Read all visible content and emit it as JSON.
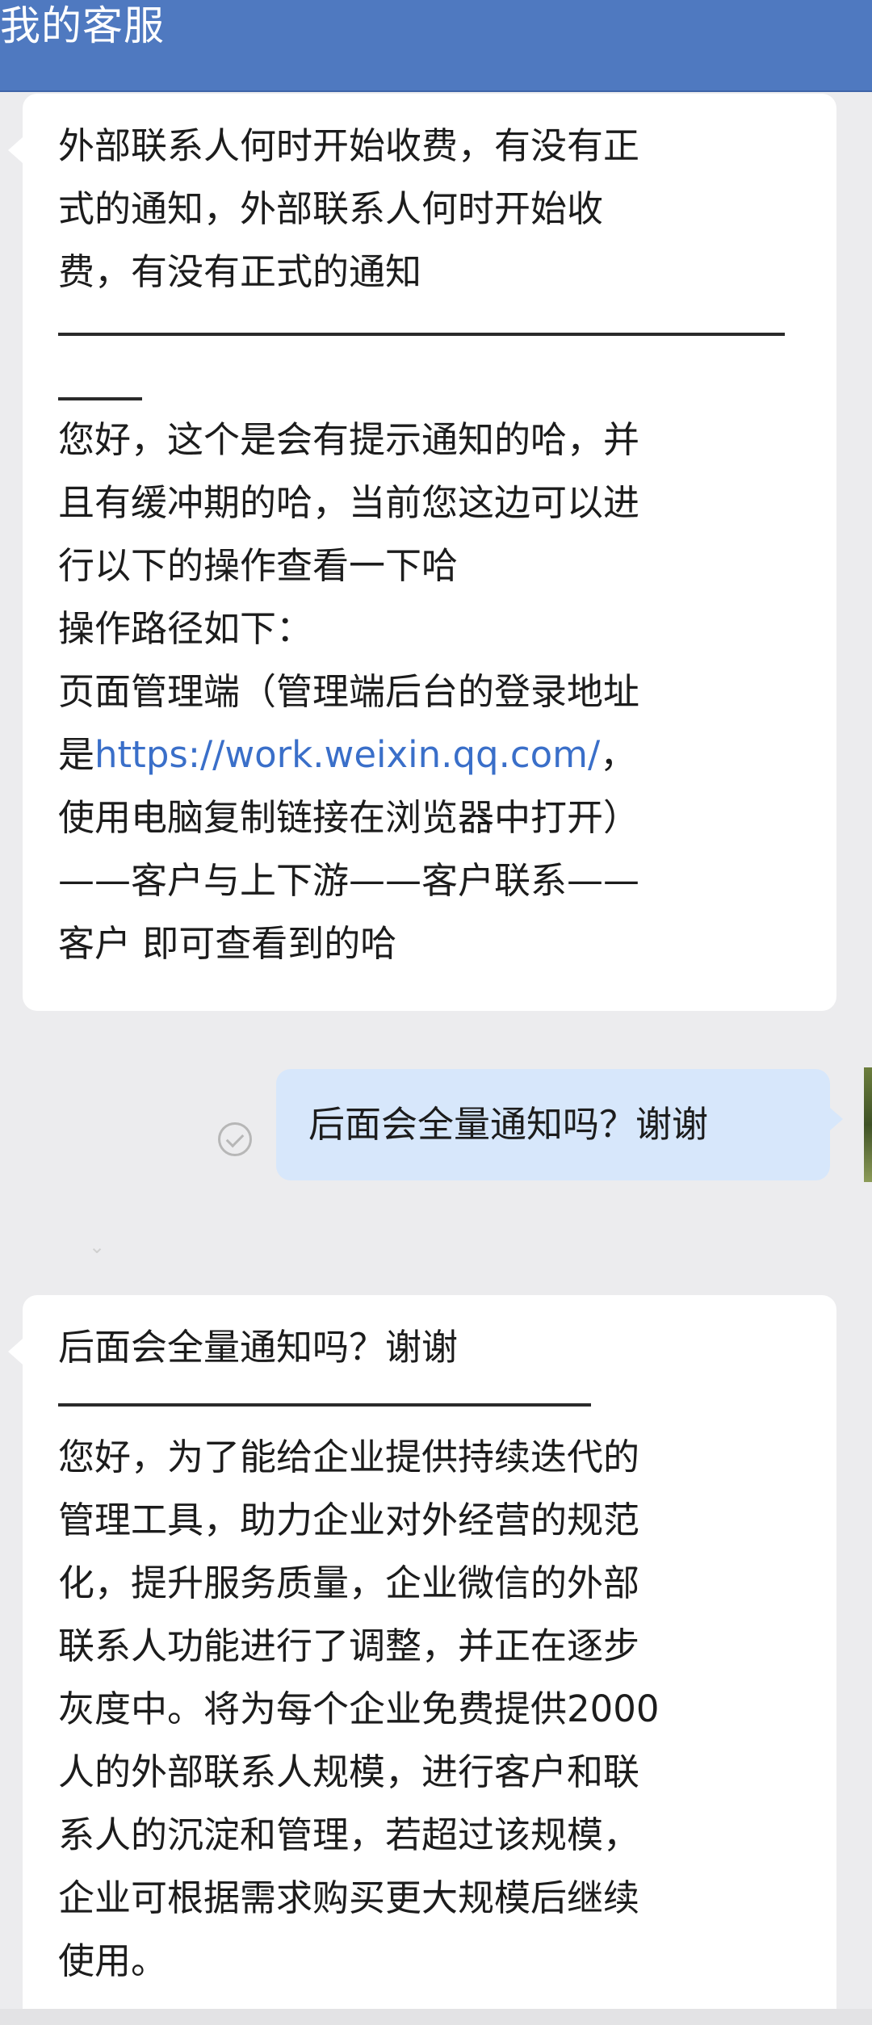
{
  "header": {
    "title": "我的客服"
  },
  "messages": {
    "first": {
      "question_lines": [
        "外部联系人何时开始收费，有没有正",
        "式的通知，外部联系人何时开始收",
        "费，有没有正式的通知"
      ],
      "answer_lines": [
        "您好，这个是会有提示通知的哈，并",
        "且有缓冲期的哈，当前您这边可以进",
        "行以下的操作查看一下哈",
        "操作路径如下：",
        "页面管理端（管理端后台的登录地址"
      ],
      "link_prefix": "是",
      "link_url": "https://work.weixin.qq.com/",
      "link_suffix": "，",
      "answer_tail_lines": [
        "使用电脑复制链接在浏览器中打开）",
        "——客户与上下游——客户联系——",
        "客户 即可查看到的哈"
      ]
    },
    "sent": {
      "text": "后面会全量通知吗？谢谢"
    },
    "second": {
      "quote": "后面会全量通知吗？谢谢",
      "answer_lines": [
        "您好，为了能给企业提供持续迭代的",
        "管理工具，助力企业对外经营的规范",
        "化，提升服务质量，企业微信的外部",
        "联系人功能进行了调整，并正在逐步",
        "灰度中。将为每个企业免费提供2000",
        "人的外部联系人规模，进行客户和联",
        "系人的沉淀和管理，若超过该规模，",
        "企业可根据需求购买更大规模后继续",
        "使用。"
      ]
    }
  },
  "icons": {
    "read_status": "check-circle-icon",
    "ghost": "chevron-down-icon"
  },
  "colors": {
    "header": "#4f79c0",
    "background": "#ececee",
    "bubble_in": "#ffffff",
    "bubble_out": "#d7e7fb",
    "link": "#3a6fc9"
  }
}
